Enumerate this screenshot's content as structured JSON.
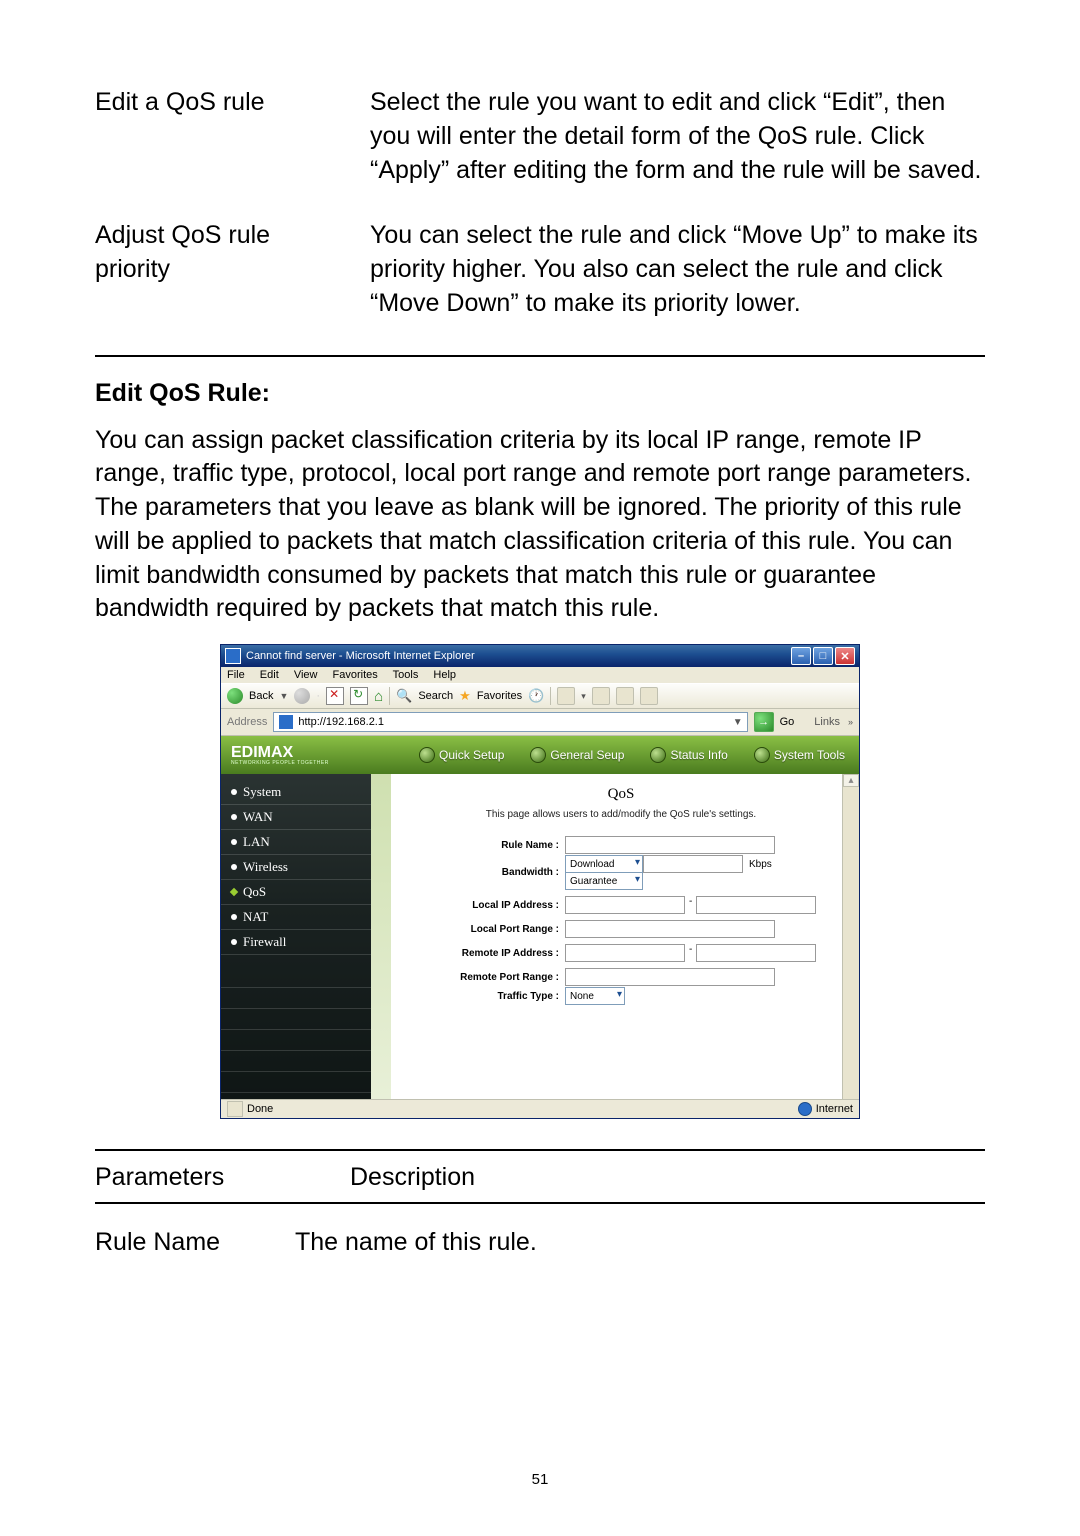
{
  "defs1": {
    "r1": {
      "term": "Edit a QoS rule",
      "desc": "Select the rule you want to edit and click “Edit”, then you will enter the detail form of the QoS rule. Click “Apply” after editing the form and the rule will be saved."
    },
    "r2": {
      "term": "Adjust QoS rule priority",
      "desc": "You can select the rule and click “Move Up” to make its priority higher. You also can select the rule and click “Move Down” to make its priority lower."
    }
  },
  "section_title": "Edit QoS Rule:",
  "body_para": "You can assign packet classification criteria by its local IP range, remote IP range, traffic type, protocol, local port range and remote port range parameters. The parameters that you leave as blank will be ignored. The priority of this rule will be applied to packets that match classification criteria of this rule. You can limit bandwidth consumed by packets that match this rule or guarantee bandwidth required by packets that match this rule.",
  "shot": {
    "window_title": "Cannot find server - Microsoft Internet Explorer",
    "menu": {
      "file": "File",
      "edit": "Edit",
      "view": "View",
      "favorites": "Favorites",
      "tools": "Tools",
      "help": "Help"
    },
    "toolbar": {
      "back": "Back",
      "search": "Search",
      "favorites": "Favorites"
    },
    "address_label": "Address",
    "url": "http://192.168.2.1",
    "go": "Go",
    "links": "Links",
    "brand": {
      "name": "EDIMAX",
      "tag": "NETWORKING PEOPLE TOGETHER"
    },
    "nav": {
      "quick": "Quick Setup",
      "general": "General Seup",
      "status": "Status Info",
      "tools": "System Tools"
    },
    "sidebar": {
      "system": "System",
      "wan": "WAN",
      "lan": "LAN",
      "wireless": "Wireless",
      "qos": "QoS",
      "nat": "NAT",
      "firewall": "Firewall"
    },
    "content": {
      "title": "QoS",
      "desc": "This page allows users to add/modify the QoS rule's settings.",
      "rule_name": "Rule Name :",
      "bandwidth": "Bandwidth :",
      "bw_dir": "Download",
      "bw_mode": "Guarantee",
      "kbps": "Kbps",
      "local_ip": "Local IP Address :",
      "local_port": "Local Port Range :",
      "remote_ip": "Remote IP Address :",
      "remote_port": "Remote Port Range :",
      "traffic_type": "Traffic Type :",
      "traffic_val": "None",
      "dash": "-"
    },
    "status": {
      "done": "Done",
      "zone": "Internet"
    }
  },
  "defs2": {
    "h1": "Parameters",
    "h2": "Description",
    "r1": {
      "term": "Rule Name",
      "desc": "The name of this rule."
    }
  },
  "page_number": "51"
}
